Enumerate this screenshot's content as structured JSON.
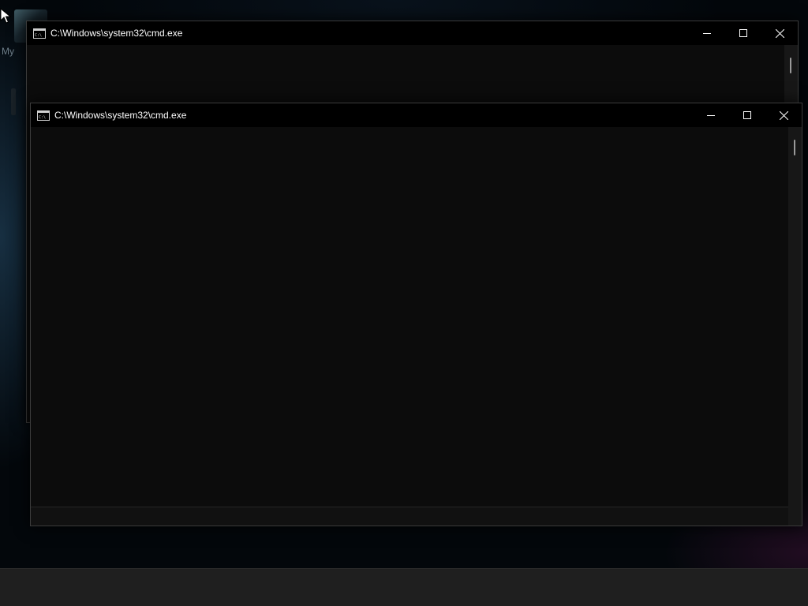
{
  "desktop": {
    "icon_label": "My"
  },
  "windows": [
    {
      "title": "C:\\Windows\\system32\\cmd.exe",
      "state": "background",
      "icon": "console-icon",
      "buttons": {
        "minimize": "minimize-icon",
        "maximize": "maximize-icon",
        "close": "close-icon"
      }
    },
    {
      "title": "C:\\Windows\\system32\\cmd.exe",
      "state": "foreground",
      "icon": "console-icon",
      "buttons": {
        "minimize": "minimize-icon",
        "maximize": "maximize-icon",
        "close": "close-icon"
      }
    }
  ],
  "colors": {
    "console_bg": "#0c0c0c",
    "titlebar_bg": "#000000",
    "title_text": "#ffffff",
    "taskbar_bg": "#1f1f1f"
  }
}
